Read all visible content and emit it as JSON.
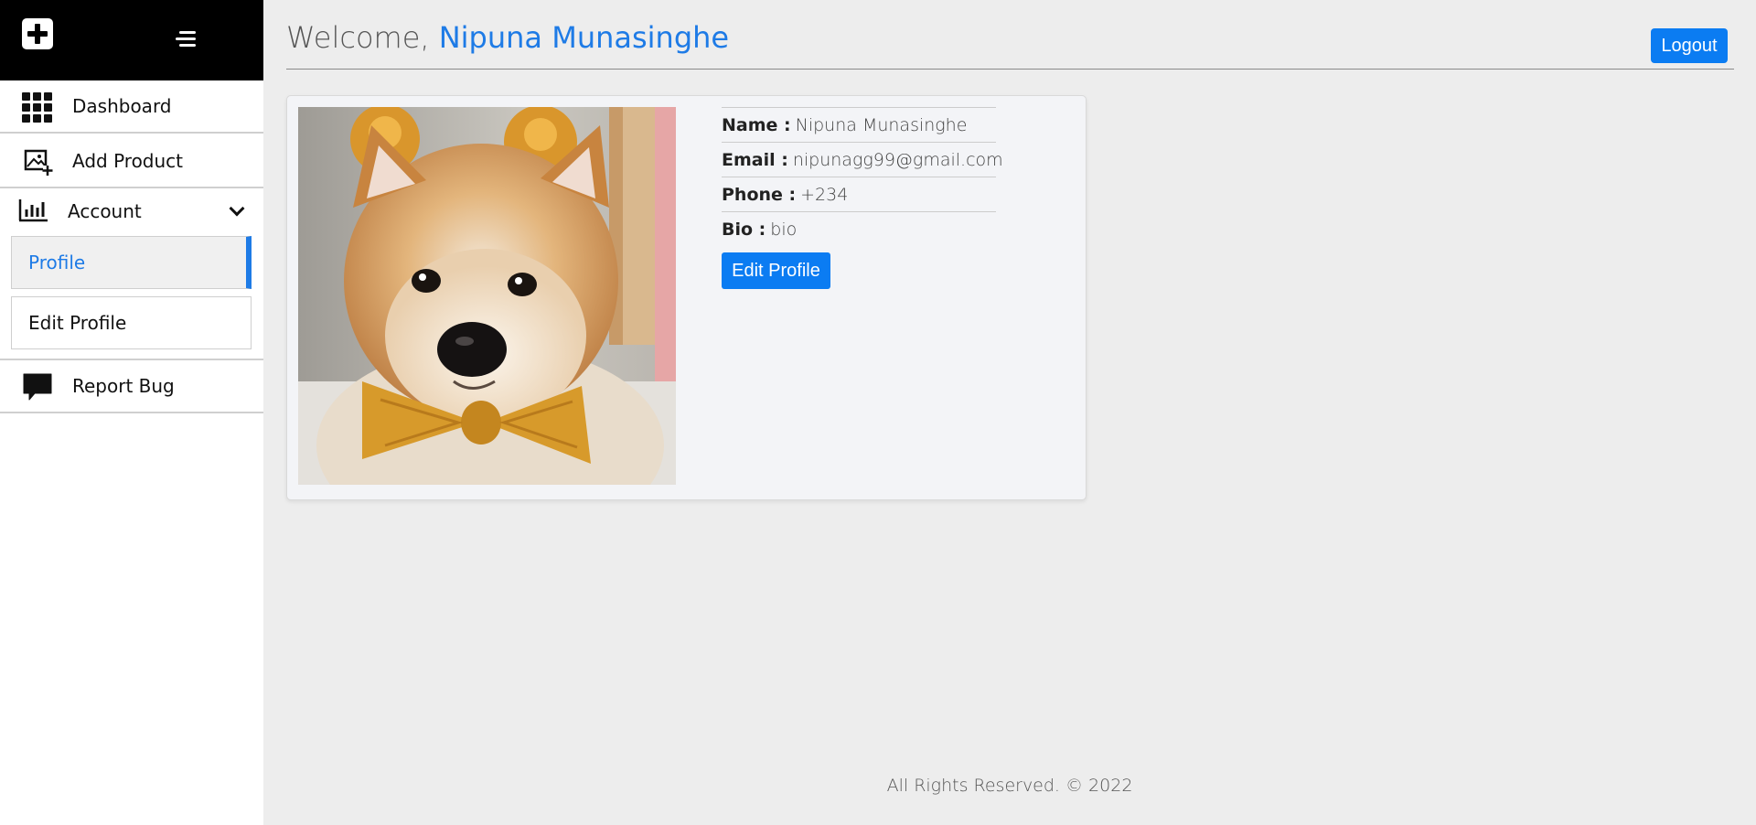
{
  "sidebar": {
    "logo_icon": "medical-cross-icon",
    "toggle_icon": "hamburger-menu-icon",
    "items": [
      {
        "label": "Dashboard",
        "icon": "grid-icon"
      },
      {
        "label": "Add Product",
        "icon": "add-image-icon"
      },
      {
        "label": "Account",
        "icon": "bar-chart-icon",
        "expanded": true,
        "children": [
          {
            "label": "Profile",
            "active": true
          },
          {
            "label": "Edit Profile",
            "active": false
          }
        ]
      },
      {
        "label": "Report Bug",
        "icon": "chat-bubble-icon"
      }
    ]
  },
  "header": {
    "greeting": "Welcome,",
    "user_name": "Nipuna Munasinghe",
    "logout_label": "Logout"
  },
  "profile": {
    "photo_alt": "Shiba Inu dog with bow tie",
    "name_label": "Name :",
    "name": "Nipuna Munasinghe",
    "email_label": "Email :",
    "email": "nipunagg99@gmail.com",
    "phone_label": "Phone :",
    "phone": "+234",
    "bio_label": "Bio :",
    "bio": "bio",
    "edit_label": "Edit Profile"
  },
  "footer": {
    "text": "All Rights Reserved. © 2022"
  },
  "colors": {
    "accent": "#1e7be6",
    "button": "#0b7cf2",
    "sidebar_header": "#000000",
    "background": "#ededed"
  }
}
